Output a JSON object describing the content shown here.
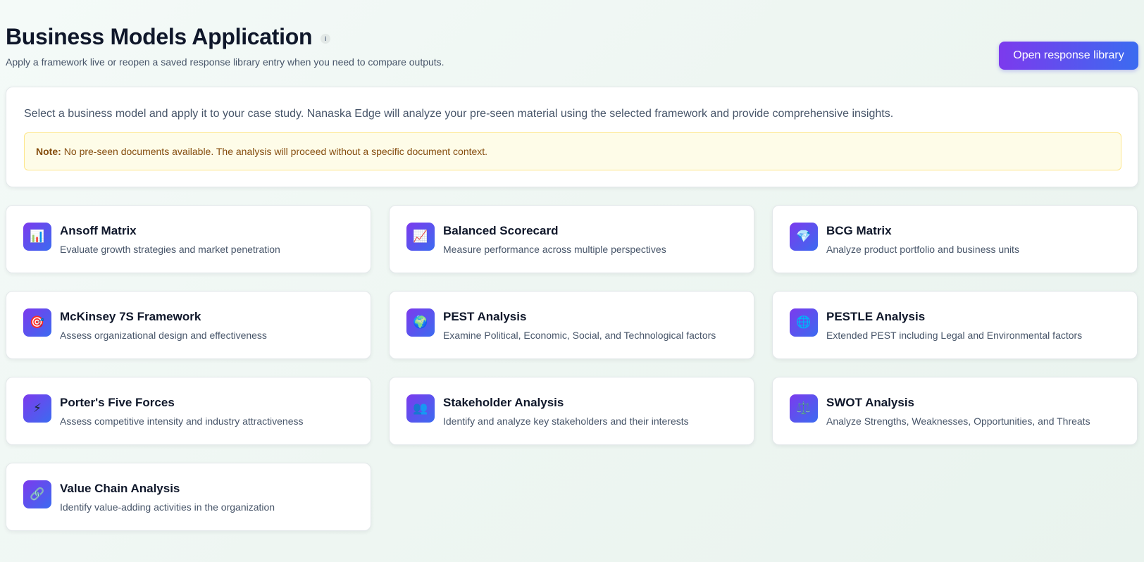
{
  "header": {
    "title": "Business Models Application",
    "info_icon": "i",
    "subtitle": "Apply a framework live or reopen a saved response library entry when you need to compare outputs.",
    "library_button": "Open response library"
  },
  "intro": {
    "text": "Select a business model and apply it to your case study. Nanaska Edge will analyze your pre-seen material using the selected framework and provide comprehensive insights.",
    "note_label": "Note:",
    "note_text": "No pre-seen documents available. The analysis will proceed without a specific document context."
  },
  "colors": {
    "accent_start": "#7c3aed",
    "accent_end": "#3b6bf0",
    "note_bg": "#fefce8",
    "note_text": "#854d0e"
  },
  "models": [
    {
      "name": "Ansoff Matrix",
      "desc": "Evaluate growth strategies and market penetration",
      "icon": "📊",
      "icon_name": "bar-chart-icon"
    },
    {
      "name": "Balanced Scorecard",
      "desc": "Measure performance across multiple perspectives",
      "icon": "📈",
      "icon_name": "trend-chart-icon"
    },
    {
      "name": "BCG Matrix",
      "desc": "Analyze product portfolio and business units",
      "icon": "💎",
      "icon_name": "gem-icon"
    },
    {
      "name": "McKinsey 7S Framework",
      "desc": "Assess organizational design and effectiveness",
      "icon": "🎯",
      "icon_name": "target-icon"
    },
    {
      "name": "PEST Analysis",
      "desc": "Examine Political, Economic, Social, and Technological factors",
      "icon": "🌍",
      "icon_name": "globe-icon"
    },
    {
      "name": "PESTLE Analysis",
      "desc": "Extended PEST including Legal and Environmental factors",
      "icon": "🌐",
      "icon_name": "web-globe-icon"
    },
    {
      "name": "Porter's Five Forces",
      "desc": "Assess competitive intensity and industry attractiveness",
      "icon": "⚡",
      "icon_name": "lightning-icon"
    },
    {
      "name": "Stakeholder Analysis",
      "desc": "Identify and analyze key stakeholders and their interests",
      "icon": "👥",
      "icon_name": "people-icon"
    },
    {
      "name": "SWOT Analysis",
      "desc": "Analyze Strengths, Weaknesses, Opportunities, and Threats",
      "icon": "⚖️",
      "icon_name": "scales-icon"
    },
    {
      "name": "Value Chain Analysis",
      "desc": "Identify value-adding activities in the organization",
      "icon": "🔗",
      "icon_name": "link-icon"
    }
  ]
}
